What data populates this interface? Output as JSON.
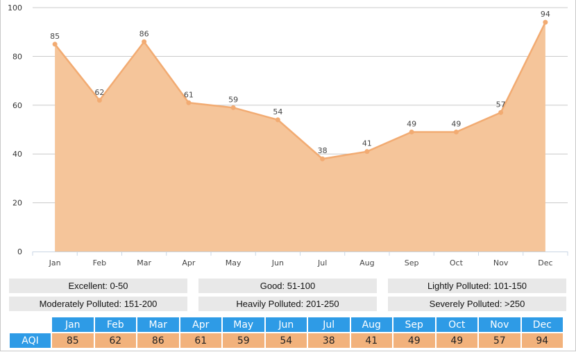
{
  "chart_data": {
    "type": "area",
    "title": "",
    "xlabel": "",
    "ylabel": "",
    "categories": [
      "Jan",
      "Feb",
      "Mar",
      "Apr",
      "May",
      "Jun",
      "Jul",
      "Aug",
      "Sep",
      "Oct",
      "Nov",
      "Dec"
    ],
    "series": [
      {
        "name": "AQI",
        "values": [
          85,
          62,
          86,
          61,
          59,
          54,
          38,
          41,
          49,
          49,
          57,
          94
        ]
      }
    ],
    "ylim": [
      0,
      100
    ],
    "yticks": [
      0,
      20,
      40,
      60,
      80,
      100
    ],
    "grid": true,
    "data_labels": true,
    "colors": {
      "line": "#f2ab72",
      "fill": "#f5c59a",
      "grid": "#c8c8c8",
      "axis": "#c8d6e4"
    }
  },
  "legend": [
    [
      "Excellent: 0-50",
      "Good: 51-100",
      "Lightly Polluted: 101-150"
    ],
    [
      "Moderately Polluted: 151-200",
      "Heavily Polluted: 201-250",
      "Severely Polluted: >250"
    ]
  ],
  "table": {
    "row_label": "AQI",
    "months": [
      "Jan",
      "Feb",
      "Mar",
      "Apr",
      "May",
      "Jun",
      "Jul",
      "Aug",
      "Sep",
      "Oct",
      "Nov",
      "Dec"
    ],
    "values": [
      "85",
      "62",
      "86",
      "61",
      "59",
      "54",
      "38",
      "41",
      "49",
      "49",
      "57",
      "94"
    ],
    "colors": {
      "header": "#2e9be6",
      "value": "#f2b27c"
    }
  }
}
